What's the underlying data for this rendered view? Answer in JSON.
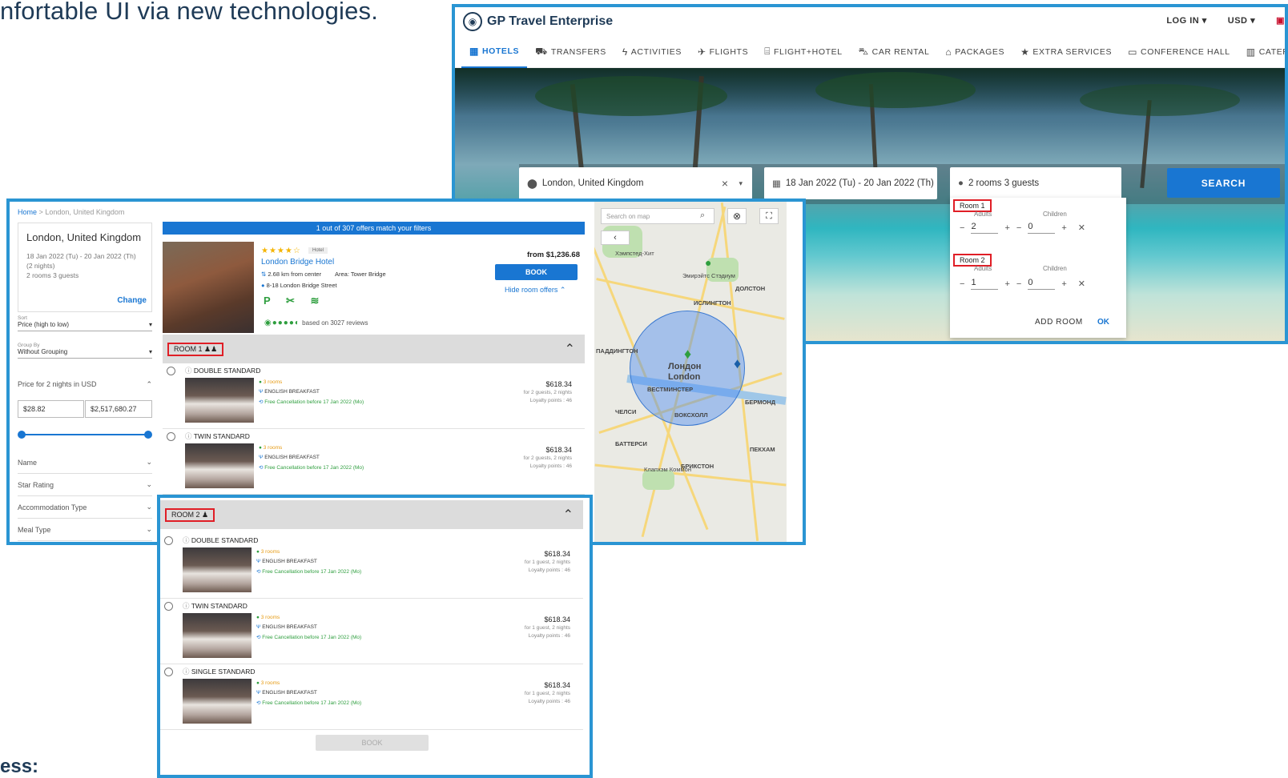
{
  "slide": {
    "headline": "nfortable UI  via new technologies.",
    "footer": "ess:"
  },
  "top": {
    "brand": "GP Travel Enterprise",
    "login": "LOG IN",
    "currency": "USD",
    "nav": [
      {
        "label": "HOTELS",
        "icon": "▦"
      },
      {
        "label": "TRANSFERS",
        "icon": "⛟"
      },
      {
        "label": "ACTIVITIES",
        "icon": "ϟ"
      },
      {
        "label": "FLIGHTS",
        "icon": "✈"
      },
      {
        "label": "FLIGHT+HOTEL",
        "icon": "⌸"
      },
      {
        "label": "CAR RENTAL",
        "icon": "⛍"
      },
      {
        "label": "PACKAGES",
        "icon": "⌂"
      },
      {
        "label": "EXTRA SERVICES",
        "icon": "★"
      },
      {
        "label": "CONFERENCE HALL",
        "icon": "▭"
      },
      {
        "label": "CATERING",
        "icon": "▥"
      }
    ],
    "destination": "London, United Kingdom",
    "dates": "18 Jan 2022 (Tu) -  20 Jan 2022 (Th)",
    "guests": "2 rooms 3 guests",
    "search": "SEARCH",
    "popup": {
      "adults_label": "Adults",
      "children_label": "Children",
      "rooms": [
        {
          "label": "Room 1",
          "adults": "2",
          "children": "0"
        },
        {
          "label": "Room 2",
          "adults": "1",
          "children": "0"
        }
      ],
      "add_room": "ADD ROOM",
      "ok": "OK"
    }
  },
  "results": {
    "breadcrumb_home": "Home",
    "breadcrumb_sep": ">",
    "breadcrumb_current": "London, United Kingdom",
    "side": {
      "title": "London, United Kingdom",
      "dates": "18 Jan 2022 (Tu) - 20 Jan 2022 (Th) (2 nights)",
      "guests": "2 rooms 3 guests",
      "change": "Change"
    },
    "sort_label": "Sort",
    "sort_value": "Price (high to low)",
    "group_label": "Group By",
    "group_value": "Without Grouping",
    "price_title": "Price for 2 nights in USD",
    "price_min": "$28.82",
    "price_max": "$2,517,680.27",
    "filters": [
      "Name",
      "Star Rating",
      "Accommodation Type",
      "Meal Type"
    ],
    "banner": "1 out of 307 offers match your filters",
    "hotel": {
      "badge": "Hotel",
      "name": "London Bridge Hotel",
      "distance": "2.68 km from center",
      "area": "Area: Tower Bridge",
      "address": "8-18 London Bridge Street",
      "amenities": "P ✂ ≋",
      "reviews": "based on 3027 reviews",
      "from_price": "from $1,236.68",
      "book": "BOOK",
      "hide_offers": "Hide room offers ⌃"
    },
    "room1": {
      "label": "ROOM 1"
    },
    "room2": {
      "label": "ROOM 2"
    },
    "rooms_common": {
      "avail": "3 rooms",
      "meal": "ENGLISH BREAKFAST",
      "cancel": "Free Cancellation before 17 Jan 2022 (Mo)",
      "price": "$618.34",
      "loyalty": "Loyalty points : 46"
    },
    "room1_offers": [
      {
        "type": "DOUBLE STANDARD",
        "guests": "for 2 guests, 2 nights"
      },
      {
        "type": "TWIN STANDARD",
        "guests": "for 2 guests, 2 nights"
      }
    ],
    "room2_offers": [
      {
        "type": "DOUBLE STANDARD",
        "guests": "for 1 guest, 2 nights"
      },
      {
        "type": "TWIN STANDARD",
        "guests": "for 1 guest, 2 nights"
      },
      {
        "type": "SINGLE STANDARD",
        "guests": "for 1 guest, 2 nights"
      }
    ],
    "book_disabled": "BOOK",
    "map": {
      "search_placeholder": "Search on map",
      "labels": [
        "Хэмпстед-Хит",
        "Эмирэйтс Стэдиум",
        "ИСЛИНГТОН",
        "ДОЛСТОН",
        "ПАДДИНГТОН",
        "Лондон",
        "London",
        "ВЕСТМИНСТЕР",
        "ВОКСХОЛЛ",
        "ЧЕЛСИ",
        "БЕРМОНД",
        "БАТТЕРСИ",
        "БРИКСТОН",
        "ПЕКХАМ",
        "Клапхэм Коммон"
      ]
    }
  }
}
